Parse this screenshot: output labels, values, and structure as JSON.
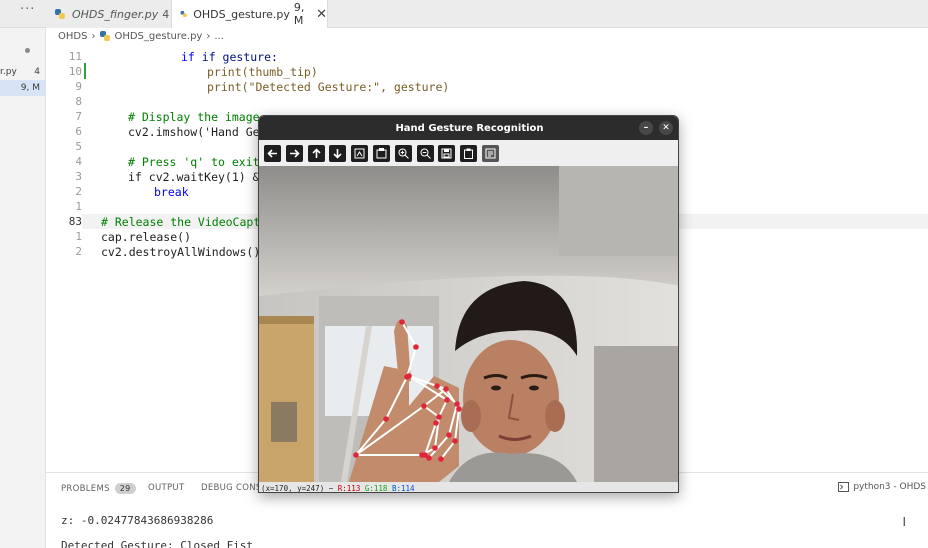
{
  "tabs": {
    "more": "···",
    "items": [
      {
        "label": "OHDS_finger.py",
        "badge": "4"
      },
      {
        "label": "OHDS_gesture.py",
        "badge": "9, M",
        "close": "✕"
      }
    ]
  },
  "explorer": {
    "rows": [
      {
        "label": "r.py",
        "value": "4"
      },
      {
        "label": "",
        "value": "9, M"
      }
    ]
  },
  "breadcrumb": [
    "OHDS",
    "OHDS_gesture.py",
    "..."
  ],
  "editor": {
    "lines": [
      {
        "num": "11",
        "text": "if gesture:"
      },
      {
        "num": "10",
        "text": "print(thumb_tip)"
      },
      {
        "num": "9",
        "text": "print(\"Detected Gesture:\", gesture)"
      },
      {
        "num": "8",
        "text": ""
      },
      {
        "num": "7",
        "text": "# Display the image."
      },
      {
        "num": "6",
        "text": "cv2.imshow('Hand Ges"
      },
      {
        "num": "5",
        "text": ""
      },
      {
        "num": "4",
        "text": "# Press 'q' to exit."
      },
      {
        "num": "3",
        "text": "if cv2.waitKey(1) & 0"
      },
      {
        "num": "2",
        "text": "break"
      },
      {
        "num": "1",
        "text": ""
      },
      {
        "num": "83",
        "text": "# Release the VideoCaptu"
      },
      {
        "num": "1",
        "text": "cap.release()"
      },
      {
        "num": "2",
        "text": "cv2.destroyAllWindows()"
      }
    ]
  },
  "panel": {
    "problems": "PROBLEMS",
    "problems_count": "29",
    "output": "OUTPUT",
    "debug": "DEBUG CONSOLE",
    "terminal_name": "python3 - OHDS",
    "lines": [
      "z: -0.02477843686938286",
      "Detected Gesture: Closed Fist"
    ]
  },
  "cv_window": {
    "title": "Hand Gesture Recognition",
    "minimize": "–",
    "close": "✕",
    "toolbar": [
      "pan-left",
      "pan-right",
      "pan-up",
      "pan-down",
      "zoom-fit",
      "zoom-original",
      "zoom-in",
      "zoom-out",
      "save",
      "copy",
      "properties"
    ],
    "status_coords": "(x=170, y=247) ~ ",
    "status_r": "R:113",
    "status_g": "G:118",
    "status_b": "B:114"
  },
  "colors": {
    "landmark": "#e0263a",
    "connection": "#ffffff",
    "titlebar": "#2c2c2c"
  }
}
